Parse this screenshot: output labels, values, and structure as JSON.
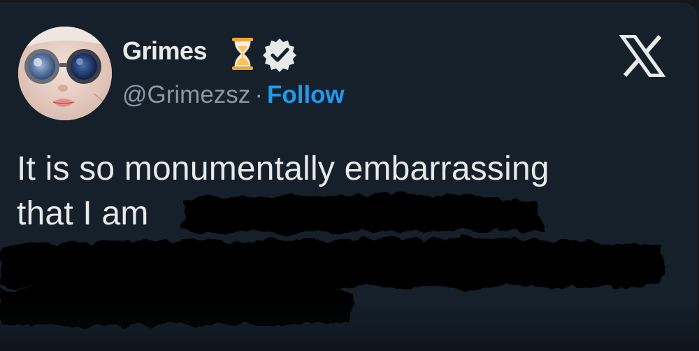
{
  "author": {
    "display_name": "Grimes",
    "handle": "@Grimezsz",
    "separator": "·",
    "follow_label": "Follow"
  },
  "tweet": {
    "line1": "It is so monumentally embarrassing",
    "line2": "that I am"
  },
  "icons": {
    "badge": "hourglass-icon",
    "verified": "verified-badge-icon",
    "close": "x-logo-icon"
  },
  "colors": {
    "background": "#15202b",
    "text": "#e7e9ea",
    "muted": "#8b98a5",
    "accent": "#1d9bf0"
  }
}
